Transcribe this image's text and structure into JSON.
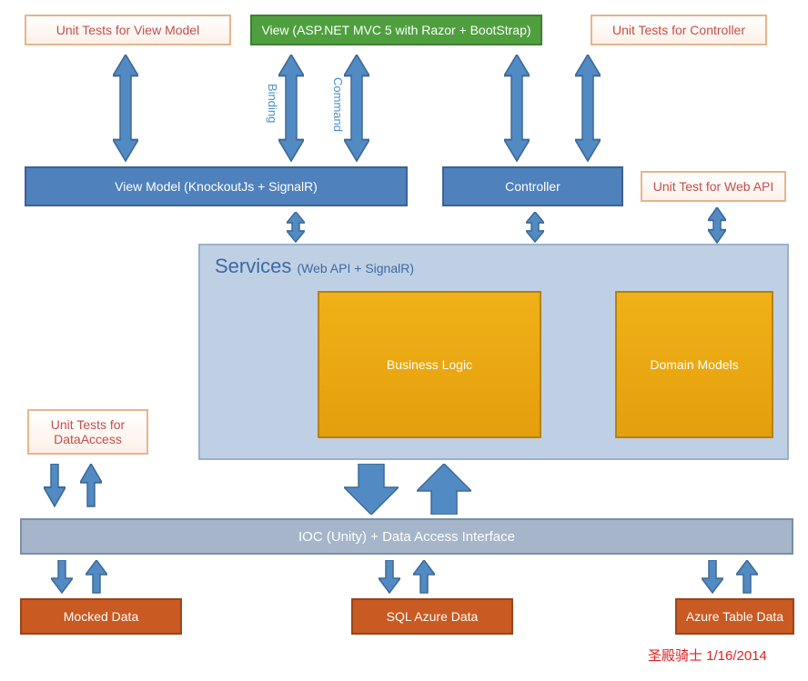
{
  "boxes": {
    "unit_tests_viewmodel": "Unit Tests for View Model",
    "view": "View (ASP.NET MVC 5 with Razor + BootStrap)",
    "unit_tests_controller": "Unit Tests for Controller",
    "viewmodel": "View Model (KnockoutJs + SignalR)",
    "controller": "Controller",
    "unit_test_webapi": "Unit Test for Web API",
    "services_title": "Services",
    "services_sub": "(Web API  +  SignalR)",
    "business_logic": "Business Logic",
    "domain_models": "Domain Models",
    "unit_tests_dataaccess": "Unit Tests for DataAccess",
    "ioc": "IOC (Unity) + Data Access Interface",
    "mocked_data": "Mocked Data",
    "sql_azure_data": "SQL Azure Data",
    "azure_table_data": "Azure Table Data"
  },
  "labels": {
    "binding": "Binding",
    "command": "Command"
  },
  "footer": "圣殿骑士 1/16/2014",
  "chart_data": {
    "type": "diagram",
    "title": "ASP.NET MVC Architecture Diagram",
    "nodes": [
      {
        "id": "ut_vm",
        "label": "Unit Tests for View Model",
        "kind": "test"
      },
      {
        "id": "view",
        "label": "View (ASP.NET MVC 5 with Razor + BootStrap)",
        "kind": "ui"
      },
      {
        "id": "ut_ctrl",
        "label": "Unit Tests for Controller",
        "kind": "test"
      },
      {
        "id": "vm",
        "label": "View Model (KnockoutJs + SignalR)",
        "kind": "component"
      },
      {
        "id": "ctrl",
        "label": "Controller",
        "kind": "component"
      },
      {
        "id": "ut_api",
        "label": "Unit Test for Web API",
        "kind": "test"
      },
      {
        "id": "services",
        "label": "Services (Web API + SignalR)",
        "kind": "container",
        "children": [
          "bl",
          "dm"
        ]
      },
      {
        "id": "bl",
        "label": "Business Logic",
        "kind": "component"
      },
      {
        "id": "dm",
        "label": "Domain Models",
        "kind": "component"
      },
      {
        "id": "ut_da",
        "label": "Unit Tests for DataAccess",
        "kind": "test"
      },
      {
        "id": "ioc",
        "label": "IOC (Unity) + Data Access Interface",
        "kind": "component"
      },
      {
        "id": "mocked",
        "label": "Mocked Data",
        "kind": "data"
      },
      {
        "id": "sql",
        "label": "SQL Azure Data",
        "kind": "data"
      },
      {
        "id": "atd",
        "label": "Azure Table Data",
        "kind": "data"
      }
    ],
    "edges": [
      {
        "from": "ut_vm",
        "to": "vm",
        "dir": "both"
      },
      {
        "from": "view",
        "to": "vm",
        "dir": "both",
        "label": "Binding"
      },
      {
        "from": "view",
        "to": "vm",
        "dir": "both",
        "label": "Command"
      },
      {
        "from": "ut_ctrl",
        "to": "ctrl",
        "dir": "both"
      },
      {
        "from": "ut_ctrl",
        "to": "ctrl",
        "dir": "both"
      },
      {
        "from": "vm",
        "to": "services",
        "dir": "both"
      },
      {
        "from": "ctrl",
        "to": "services",
        "dir": "both"
      },
      {
        "from": "ut_api",
        "to": "services",
        "dir": "both"
      },
      {
        "from": "services",
        "to": "ioc",
        "dir": "both",
        "style": "large"
      },
      {
        "from": "ut_da",
        "to": "ioc",
        "dir": "both",
        "style": "pair"
      },
      {
        "from": "ioc",
        "to": "mocked",
        "dir": "both",
        "style": "pair"
      },
      {
        "from": "ioc",
        "to": "sql",
        "dir": "both",
        "style": "pair"
      },
      {
        "from": "ioc",
        "to": "atd",
        "dir": "both",
        "style": "pair"
      }
    ],
    "footer": "圣殿骑士 1/16/2014"
  }
}
